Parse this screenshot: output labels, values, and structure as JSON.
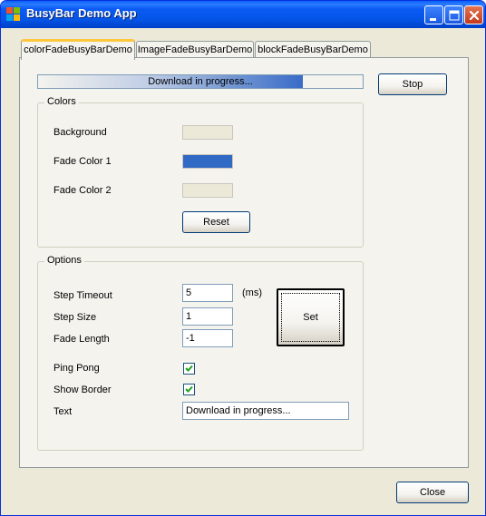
{
  "window": {
    "title": "BusyBar Demo App"
  },
  "tabs": [
    {
      "label": "colorFadeBusyBarDemo",
      "active": true
    },
    {
      "label": "ImageFadeBusyBarDemo",
      "active": false
    },
    {
      "label": "blockFadeBusyBarDemo",
      "active": false
    }
  ],
  "busy_bar": {
    "text": "Download in progress..."
  },
  "buttons": {
    "stop": "Stop",
    "reset": "Reset",
    "set": "Set",
    "close": "Close"
  },
  "colors_group": {
    "title": "Colors",
    "background_label": "Background",
    "fade_color_1_label": "Fade Color 1",
    "fade_color_2_label": "Fade Color 2",
    "background_color": "#ece9d8",
    "fade_color_1": "#316ac5",
    "fade_color_2": "#ece9d8"
  },
  "options_group": {
    "title": "Options",
    "step_timeout_label": "Step Timeout",
    "step_timeout_value": "5",
    "step_timeout_unit": "(ms)",
    "step_size_label": "Step Size",
    "step_size_value": "1",
    "fade_length_label": "Fade Length",
    "fade_length_value": "-1",
    "ping_pong_label": "Ping Pong",
    "ping_pong_checked": true,
    "show_border_label": "Show Border",
    "show_border_checked": true,
    "text_label": "Text",
    "text_value": "Download in progress..."
  },
  "icons": {
    "app": "windows-logo-icon",
    "minimize": "minimize-icon",
    "maximize": "maximize-icon",
    "close": "close-icon",
    "checkmark": "checkmark-icon"
  }
}
